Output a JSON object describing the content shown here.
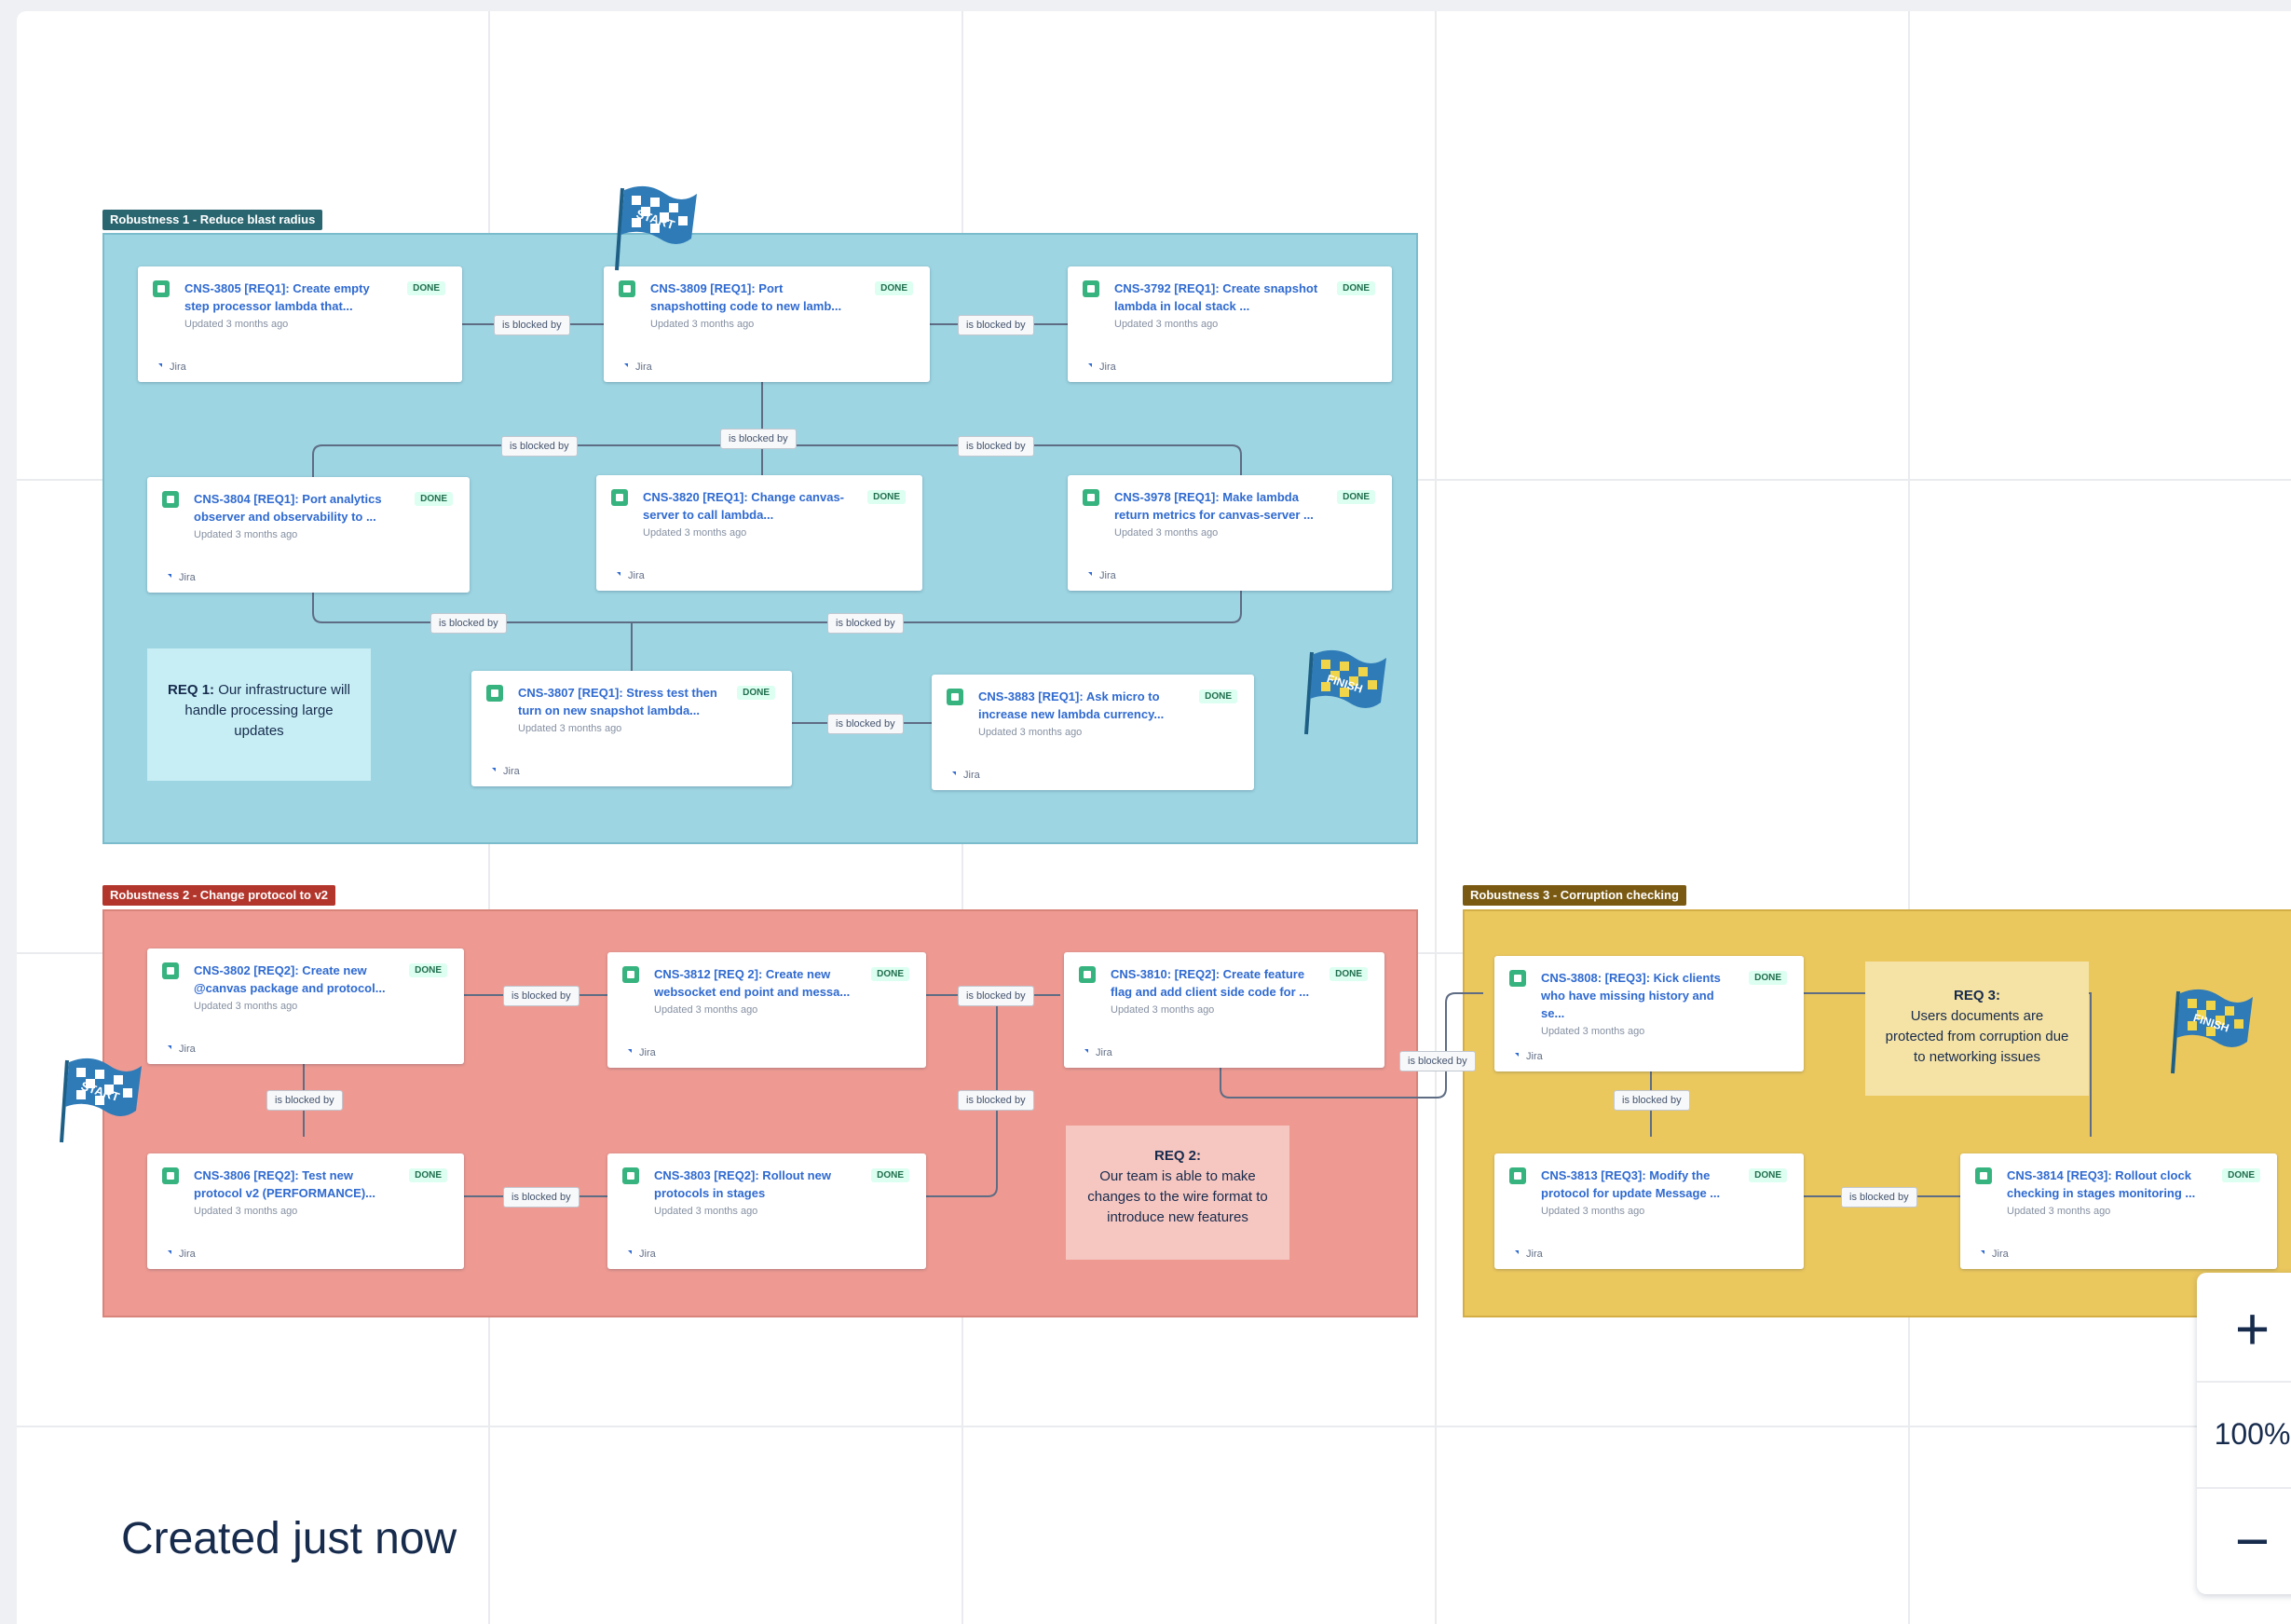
{
  "frames": [
    {
      "label": "Robustness 1 - Reduce blast radius"
    },
    {
      "label": "Robustness 2 - Change protocol to v2"
    },
    {
      "label": "Robustness 3 - Corruption checking"
    }
  ],
  "cards": [
    {
      "key": "CNS-3805 [REQ1]: Create empty step processor lambda that...",
      "status": "DONE",
      "updated": "Updated 3 months ago",
      "source": "Jira"
    },
    {
      "key": "CNS-3809 [REQ1]: Port snapshotting code to new lamb...",
      "status": "DONE",
      "updated": "Updated 3 months ago",
      "source": "Jira"
    },
    {
      "key": "CNS-3792 [REQ1]: Create snapshot lambda in local stack ...",
      "status": "DONE",
      "updated": "Updated 3 months ago",
      "source": "Jira"
    },
    {
      "key": "CNS-3804 [REQ1]: Port analytics observer and observability to ...",
      "status": "DONE",
      "updated": "Updated 3 months ago",
      "source": "Jira"
    },
    {
      "key": "CNS-3820 [REQ1]: Change canvas-server to call lambda...",
      "status": "DONE",
      "updated": "Updated 3 months ago",
      "source": "Jira"
    },
    {
      "key": "CNS-3978 [REQ1]: Make lambda return metrics for canvas-server ...",
      "status": "DONE",
      "updated": "Updated 3 months ago",
      "source": "Jira"
    },
    {
      "key": "CNS-3807 [REQ1]: Stress test then turn on new snapshot lambda...",
      "status": "DONE",
      "updated": "Updated 3 months ago",
      "source": "Jira"
    },
    {
      "key": "CNS-3883 [REQ1]: Ask micro to increase new lambda currency...",
      "status": "DONE",
      "updated": "Updated 3 months ago",
      "source": "Jira"
    },
    {
      "key": "CNS-3802 [REQ2]: Create new @canvas package and protocol...",
      "status": "DONE",
      "updated": "Updated 3 months ago",
      "source": "Jira"
    },
    {
      "key": "CNS-3812 [REQ 2]: Create new websocket end point and messa...",
      "status": "DONE",
      "updated": "Updated 3 months ago",
      "source": "Jira"
    },
    {
      "key": "CNS-3810: [REQ2]: Create feature flag and add client side code for ...",
      "status": "DONE",
      "updated": "Updated 3 months ago",
      "source": "Jira"
    },
    {
      "key": "CNS-3806 [REQ2]: Test new protocol v2 (PERFORMANCE)...",
      "status": "DONE",
      "updated": "Updated 3 months ago",
      "source": "Jira"
    },
    {
      "key": "CNS-3803 [REQ2]: Rollout new protocols in stages",
      "status": "DONE",
      "updated": "Updated 3 months ago",
      "source": "Jira"
    },
    {
      "key": "CNS-3808: [REQ3]: Kick clients who have missing history and se...",
      "status": "DONE",
      "updated": "Updated 3 months ago",
      "source": "Jira"
    },
    {
      "key": "CNS-3813 [REQ3]: Modify the protocol for update Message ...",
      "status": "DONE",
      "updated": "Updated 3 months ago",
      "source": "Jira"
    },
    {
      "key": "CNS-3814 [REQ3]: Rollout clock checking in stages monitoring ...",
      "status": "DONE",
      "updated": "Updated 3 months ago",
      "source": "Jira"
    }
  ],
  "link_label": "is blocked by",
  "notes": [
    {
      "title": "REQ 1:",
      "text": "Our infrastructure will handle processing large updates"
    },
    {
      "title": "REQ 2:",
      "text": "Our team is able to make changes to the wire format to introduce new features"
    },
    {
      "title": "REQ 3:",
      "text": "Users documents are protected from corruption due to networking issues"
    }
  ],
  "flags": [
    {
      "text": "START",
      "icon": "start-flag-icon"
    },
    {
      "text": "FINISH",
      "icon": "finish-flag-icon"
    },
    {
      "text": "START",
      "icon": "start-flag-icon"
    },
    {
      "text": "FINISH",
      "icon": "finish-flag-icon"
    }
  ],
  "footer": {
    "created": "Created just now"
  },
  "zoom": {
    "in_label": "+",
    "level": "100%",
    "out_label": "−"
  },
  "colors": {
    "frame_blue": "#9dd5e2",
    "frame_red": "#ee9a92",
    "frame_yellow": "#ebc85e",
    "status_done": "#216e4e",
    "link": "#2f6ad0"
  }
}
